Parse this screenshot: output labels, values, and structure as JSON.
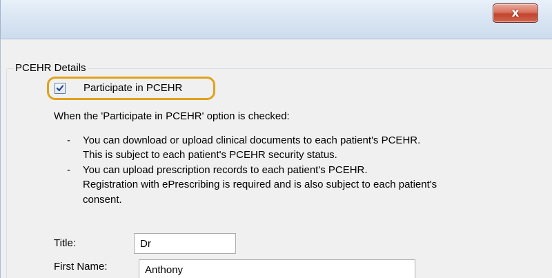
{
  "window": {
    "close_glyph": "x"
  },
  "group": {
    "title": "PCEHR Details"
  },
  "participate": {
    "label": "Participate in PCEHR",
    "checked": true,
    "highlight_color": "#e0a21a"
  },
  "info": {
    "intro": "When the 'Participate in PCEHR' option is checked:",
    "bullet_mark": "-",
    "bullets": [
      {
        "lines": [
          "You can download or upload clinical documents to each patient's PCEHR.",
          "This is subject to each patient's PCEHR security status."
        ]
      },
      {
        "lines": [
          "You can upload prescription records to each patient's PCEHR.",
          "Registration with ePrescribing is required and is also subject to each patient's",
          "consent."
        ]
      }
    ]
  },
  "form": {
    "title_label": "Title:",
    "title_value": "Dr",
    "first_name_label": "First Name:",
    "first_name_value": "Anthony"
  }
}
